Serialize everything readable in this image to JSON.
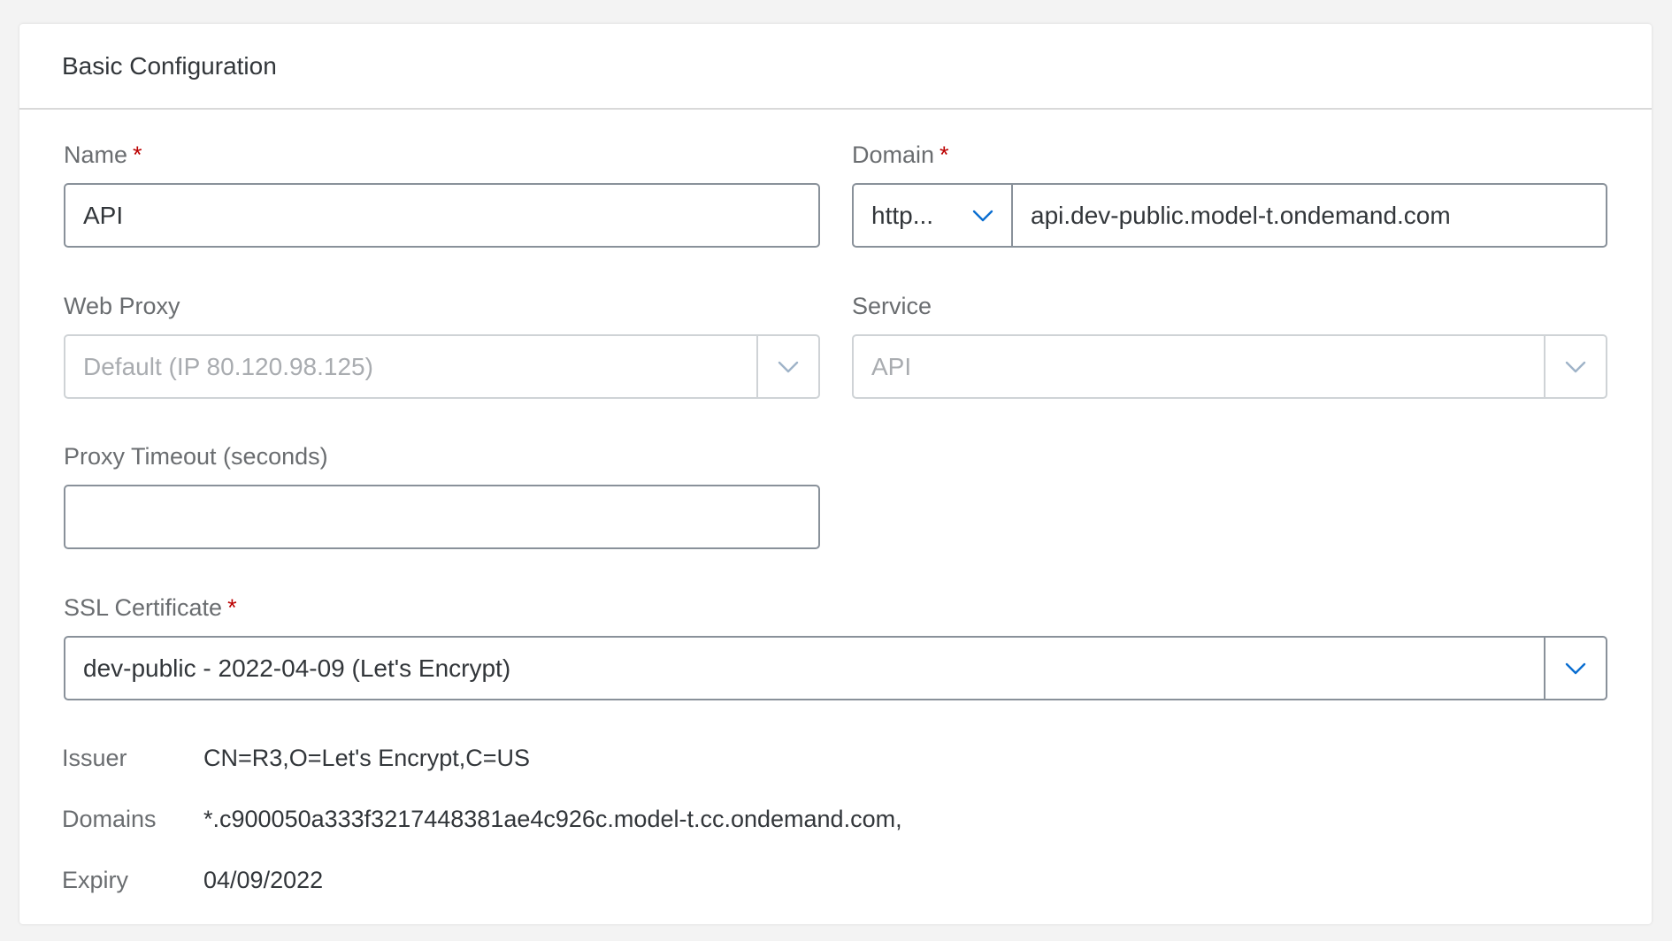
{
  "card": {
    "title": "Basic Configuration"
  },
  "fields": {
    "name": {
      "label": "Name",
      "required_mark": "*",
      "value": "API"
    },
    "domain": {
      "label": "Domain",
      "required_mark": "*",
      "protocol": "http...",
      "value": "api.dev-public.model-t.ondemand.com"
    },
    "web_proxy": {
      "label": "Web Proxy",
      "value": "Default (IP 80.120.98.125)"
    },
    "service": {
      "label": "Service",
      "value": "API"
    },
    "proxy_timeout": {
      "label": "Proxy Timeout (seconds)",
      "value": ""
    },
    "ssl_certificate": {
      "label": "SSL Certificate",
      "required_mark": "*",
      "value": "dev-public - 2022-04-09 (Let's Encrypt)"
    }
  },
  "certificate_details": [
    {
      "key": "Issuer",
      "value": "CN=R3,O=Let's Encrypt,C=US"
    },
    {
      "key": "Domains",
      "value": "*.c900050a333f3217448381ae4c926c.model-t.cc.ondemand.com,"
    },
    {
      "key": "Expiry",
      "value": "04/09/2022"
    }
  ],
  "colors": {
    "accent": "#0a6ed1",
    "required": "#bb0000",
    "label": "#6a6d70",
    "text": "#32363a"
  },
  "icons": {
    "dropdown": "chevron-down-icon"
  }
}
